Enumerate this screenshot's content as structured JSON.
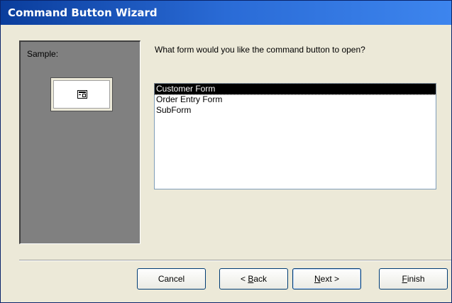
{
  "window": {
    "title": "Command Button Wizard"
  },
  "sample": {
    "label": "Sample:",
    "button_icon": "form-icon"
  },
  "question": "What form would you like the command button to open?",
  "forms": {
    "items": [
      {
        "label": "Customer Form",
        "selected": true
      },
      {
        "label": "Order Entry Form",
        "selected": false
      },
      {
        "label": "SubForm",
        "selected": false
      }
    ]
  },
  "buttons": {
    "cancel": "Cancel",
    "back_prefix": "< ",
    "back_mnemonic": "B",
    "back_rest": "ack",
    "next_mnemonic": "N",
    "next_rest": "ext >",
    "finish_mnemonic": "F",
    "finish_rest": "inish"
  }
}
